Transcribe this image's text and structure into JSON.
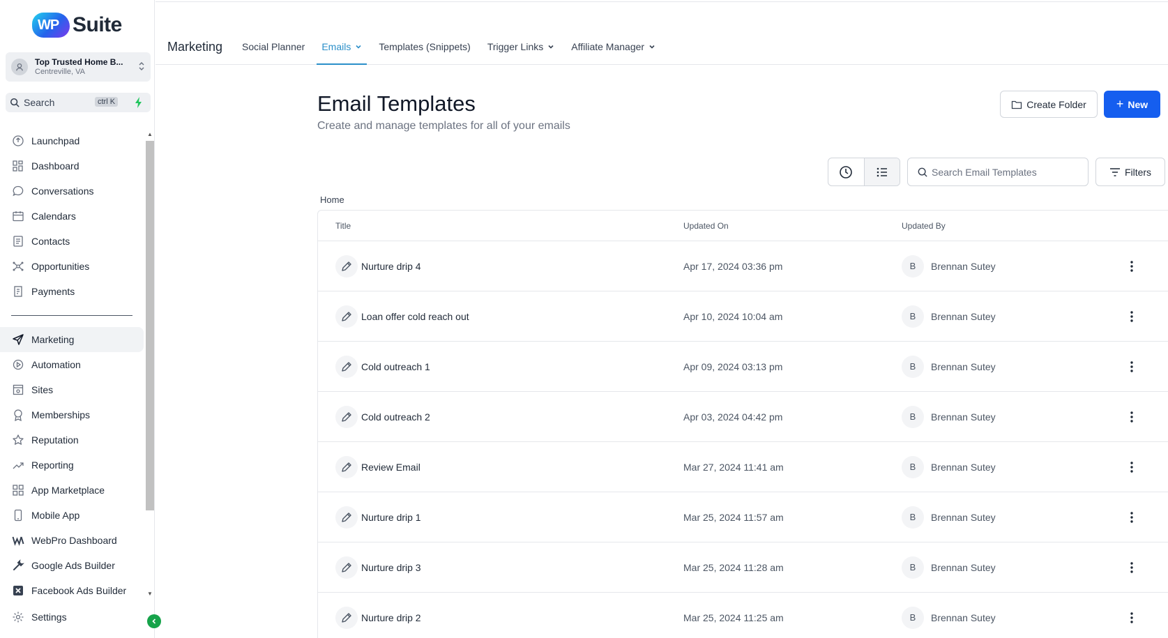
{
  "brand": {
    "badge": "WP",
    "name": "Suite"
  },
  "account": {
    "name": "Top Trusted Home B...",
    "location": "Centreville, VA"
  },
  "search": {
    "label": "Search",
    "shortcut": "ctrl K"
  },
  "sidebar": {
    "items": [
      {
        "label": "Launchpad",
        "icon": "rocket-icon"
      },
      {
        "label": "Dashboard",
        "icon": "grid-icon"
      },
      {
        "label": "Conversations",
        "icon": "chat-icon"
      },
      {
        "label": "Calendars",
        "icon": "calendar-icon"
      },
      {
        "label": "Contacts",
        "icon": "contacts-icon"
      },
      {
        "label": "Opportunities",
        "icon": "network-icon"
      },
      {
        "label": "Payments",
        "icon": "receipt-icon"
      }
    ],
    "items2": [
      {
        "label": "Marketing",
        "icon": "send-icon"
      },
      {
        "label": "Automation",
        "icon": "automation-icon"
      },
      {
        "label": "Sites",
        "icon": "sites-icon"
      },
      {
        "label": "Memberships",
        "icon": "badge-icon"
      },
      {
        "label": "Reputation",
        "icon": "star-icon"
      },
      {
        "label": "Reporting",
        "icon": "trend-icon"
      },
      {
        "label": "App Marketplace",
        "icon": "apps-icon"
      },
      {
        "label": "Mobile App",
        "icon": "phone-icon"
      },
      {
        "label": "WebPro Dashboard",
        "icon": "webpro-icon"
      },
      {
        "label": "Google Ads Builder",
        "icon": "wrench-icon"
      },
      {
        "label": "Facebook Ads Builder",
        "icon": "x-box-icon"
      }
    ],
    "settings": "Settings"
  },
  "topnav": {
    "section": "Marketing",
    "tabs": [
      "Social Planner",
      "Emails",
      "Templates (Snippets)",
      "Trigger Links",
      "Affiliate Manager"
    ]
  },
  "main": {
    "title": "Email Templates",
    "subtitle": "Create and manage templates for all of your emails",
    "create_folder": "Create Folder",
    "new": "New",
    "search_placeholder": "Search Email Templates",
    "filters": "Filters",
    "breadcrumb": "Home"
  },
  "table": {
    "headers": [
      "Title",
      "Updated On",
      "Updated By"
    ],
    "rows": [
      {
        "title": "Nurture drip 4",
        "updated_on": "Apr 17, 2024 03:36 pm",
        "initial": "B",
        "updated_by": "Brennan Sutey"
      },
      {
        "title": "Loan offer cold reach out",
        "updated_on": "Apr 10, 2024 10:04 am",
        "initial": "B",
        "updated_by": "Brennan Sutey"
      },
      {
        "title": "Cold outreach 1",
        "updated_on": "Apr 09, 2024 03:13 pm",
        "initial": "B",
        "updated_by": "Brennan Sutey"
      },
      {
        "title": "Cold outreach 2",
        "updated_on": "Apr 03, 2024 04:42 pm",
        "initial": "B",
        "updated_by": "Brennan Sutey"
      },
      {
        "title": "Review Email",
        "updated_on": "Mar 27, 2024 11:41 am",
        "initial": "B",
        "updated_by": "Brennan Sutey"
      },
      {
        "title": "Nurture drip 1",
        "updated_on": "Mar 25, 2024 11:57 am",
        "initial": "B",
        "updated_by": "Brennan Sutey"
      },
      {
        "title": "Nurture drip 3",
        "updated_on": "Mar 25, 2024 11:28 am",
        "initial": "B",
        "updated_by": "Brennan Sutey"
      },
      {
        "title": "Nurture drip 2",
        "updated_on": "Mar 25, 2024 11:25 am",
        "initial": "B",
        "updated_by": "Brennan Sutey"
      }
    ]
  },
  "colors": {
    "accent": "#2b8fc9",
    "primary": "#155eef",
    "collapse": "#16a34a"
  }
}
